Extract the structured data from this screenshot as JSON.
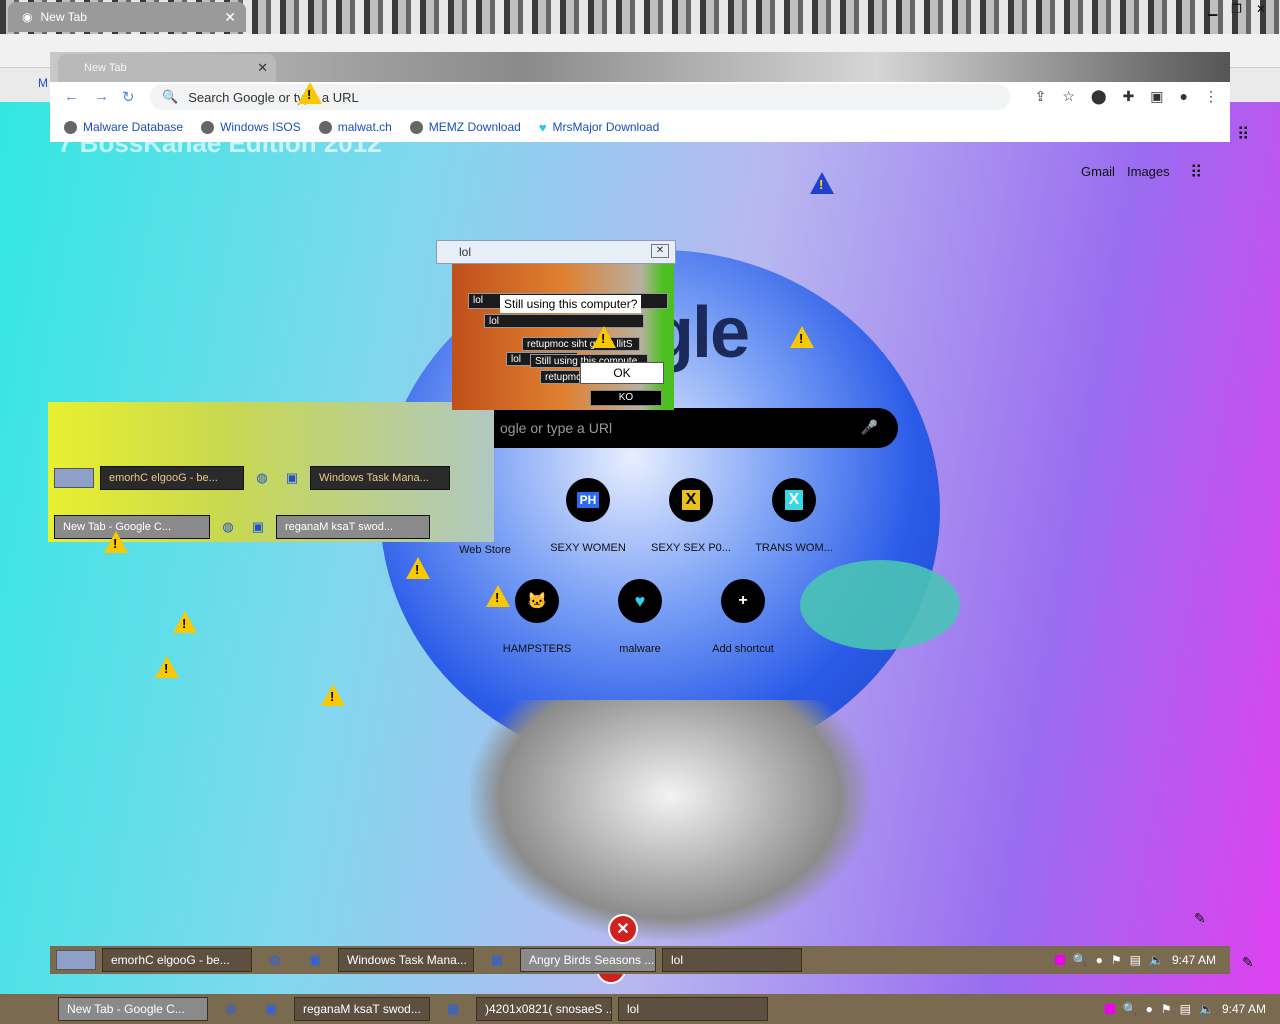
{
  "outer_browser": {
    "tab_title": "New Tab",
    "bookmark_letter": "M",
    "omnibox_ghost": "Search Google or type a URL"
  },
  "inner_browser": {
    "tab_title": "New Tab",
    "omnibox_placeholder": "Search Google or type a URL",
    "bookmarks": [
      {
        "label": "Malware Database",
        "icon": "globe-icon"
      },
      {
        "label": "Windows ISOS",
        "icon": "globe-icon"
      },
      {
        "label": "malwat.ch",
        "icon": "person-icon"
      },
      {
        "label": "MEMZ Download",
        "icon": "globe-icon"
      },
      {
        "label": "MrsMajor Download",
        "icon": "heart-icon"
      }
    ]
  },
  "ntp": {
    "overlay_title": "7 BossKanae Edition 2012",
    "gmail": "Gmail",
    "images": "Images",
    "search_placeholder": "ogle or type a URl",
    "logo_fragment": "gle",
    "shortcuts_row1": [
      {
        "label": "Web Store",
        "badge": ""
      },
      {
        "label": "SEXY WOMEN",
        "badge": "PH"
      },
      {
        "label": "SEXY SEX P0...",
        "badge": "X"
      },
      {
        "label": "TRANS WOM...",
        "badge": "X"
      }
    ],
    "shortcuts_row2": [
      {
        "label": "HAMPSTERS",
        "badge": "🐱"
      },
      {
        "label": "malware",
        "badge": "♥"
      },
      {
        "label": "Add shortcut",
        "badge": "+"
      }
    ]
  },
  "dialog": {
    "title": "lol",
    "message": "Still using this computer?",
    "ok_label": "OK",
    "ko_label": "KO",
    "nested_titles": [
      "lol",
      "lol",
      "lol"
    ],
    "mirrored_text": "retupmoc siht gnisu llitS",
    "mini_message": "Still using this compute",
    "mini_mirror": "retupmo"
  },
  "ghost_taskbar_1": {
    "items": [
      "emorhC elgooG - be...",
      "Windows Task Mana..."
    ]
  },
  "ghost_taskbar_2": {
    "items": [
      "New Tab - Google C...",
      "reganaM ksaT swod..."
    ]
  },
  "inner_taskbar": {
    "items": [
      "emorhC elgooG - be...",
      "Windows Task Mana...",
      "Angry Birds Seasons ...",
      "lol"
    ],
    "clock": "9:47 AM"
  },
  "outer_taskbar": {
    "items": [
      "New Tab - Google C...",
      "reganaM ksaT swod...",
      ")4201x0821( snosaeS ...",
      "lol"
    ],
    "clock": "9:47 AM"
  },
  "colors": {
    "warning": "#f8c800",
    "taskbar": "#7a6a50",
    "bookmark_link": "#1a4fbf"
  }
}
